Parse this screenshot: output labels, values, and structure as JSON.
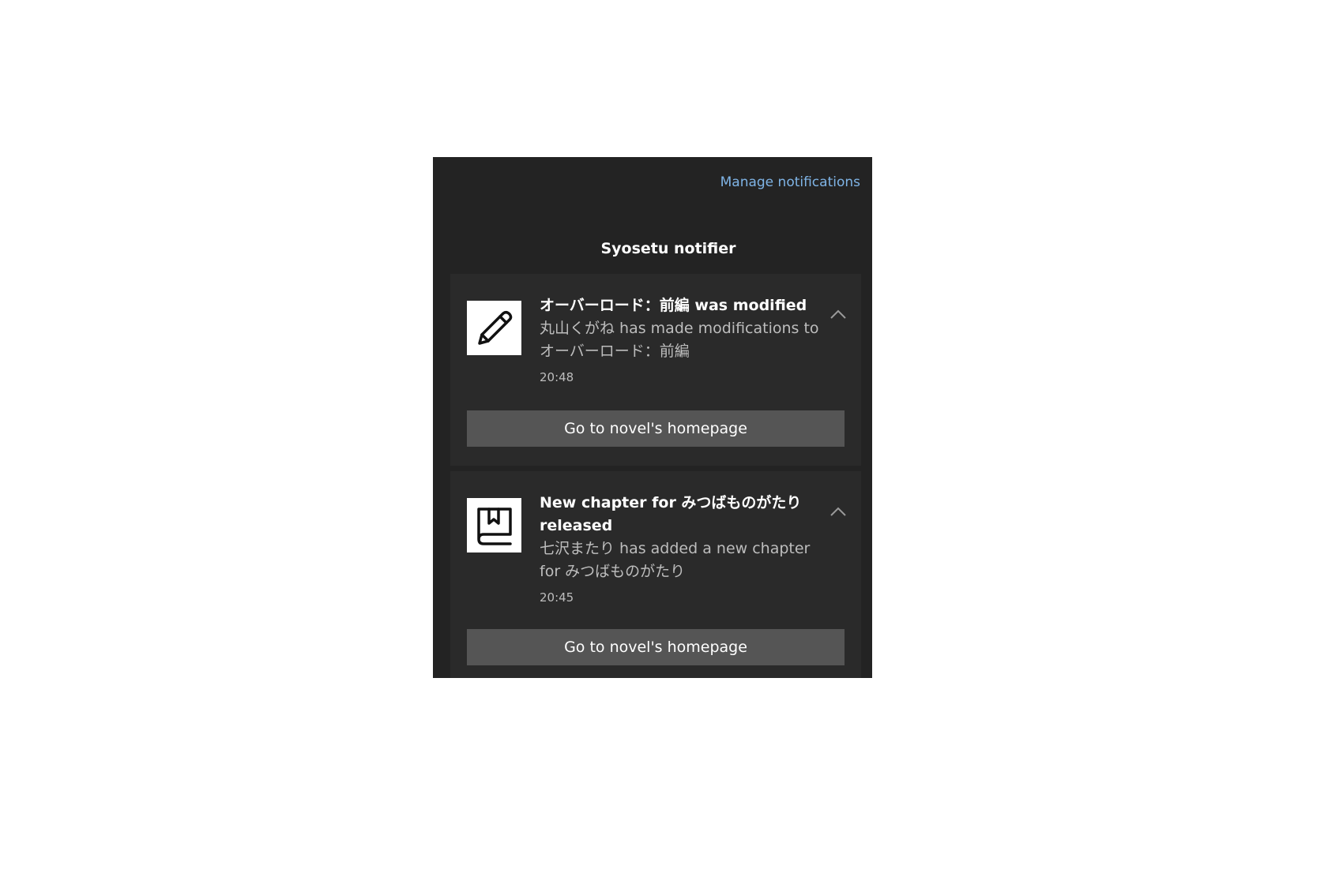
{
  "header": {
    "manage_link": "Manage notifications",
    "app_title": "Syosetu notifier"
  },
  "notifications": [
    {
      "icon": "pencil-icon",
      "title": "オーバーロード：前編 was modified",
      "body": "丸山くがね has made modifications to オーバーロード：前編",
      "time": "20:48",
      "action": "Go to novel's homepage"
    },
    {
      "icon": "book-icon",
      "title": "New chapter for みつばものがたり released",
      "body": "七沢またり has added a new chapter for みつばものがたり",
      "time": "20:45",
      "action": "Go to novel's homepage"
    }
  ]
}
